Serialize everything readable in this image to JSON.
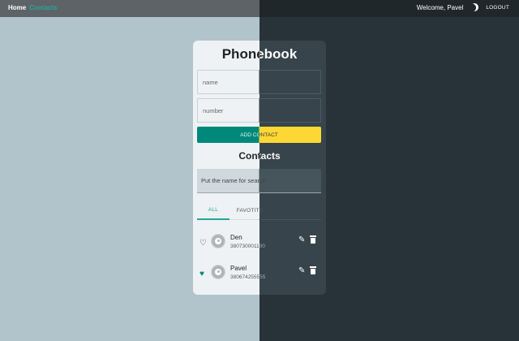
{
  "nav": {
    "home": "Home",
    "contacts": "Contacts"
  },
  "user": {
    "welcome": "Welcome, Pavel",
    "logout": "LOGOUT"
  },
  "app": {
    "title": "Phonebook",
    "name_placeholder": "name",
    "number_placeholder": "number",
    "add_button": "ADD CONTACT",
    "contacts_title": "Contacts",
    "search_placeholder": "Put the name for search",
    "tabs": [
      {
        "label": "ALL",
        "active": true
      },
      {
        "label": "FAVOTITE",
        "active": false
      }
    ],
    "contacts": [
      {
        "name": "Den",
        "phone": "380730001100",
        "favorite": false
      },
      {
        "name": "Pavel",
        "phone": "380674255555",
        "favorite": true
      }
    ]
  },
  "colors": {
    "accent": "#26a69a",
    "add_button_left": "#00897b",
    "add_button_right": "#fdd835",
    "light_bg": "#b1c3cb",
    "dark_bg": "#283339"
  },
  "icons": [
    "moon-icon",
    "heart-outline-icon",
    "heart-filled-icon",
    "avatar-icon",
    "edit-icon",
    "delete-icon"
  ]
}
